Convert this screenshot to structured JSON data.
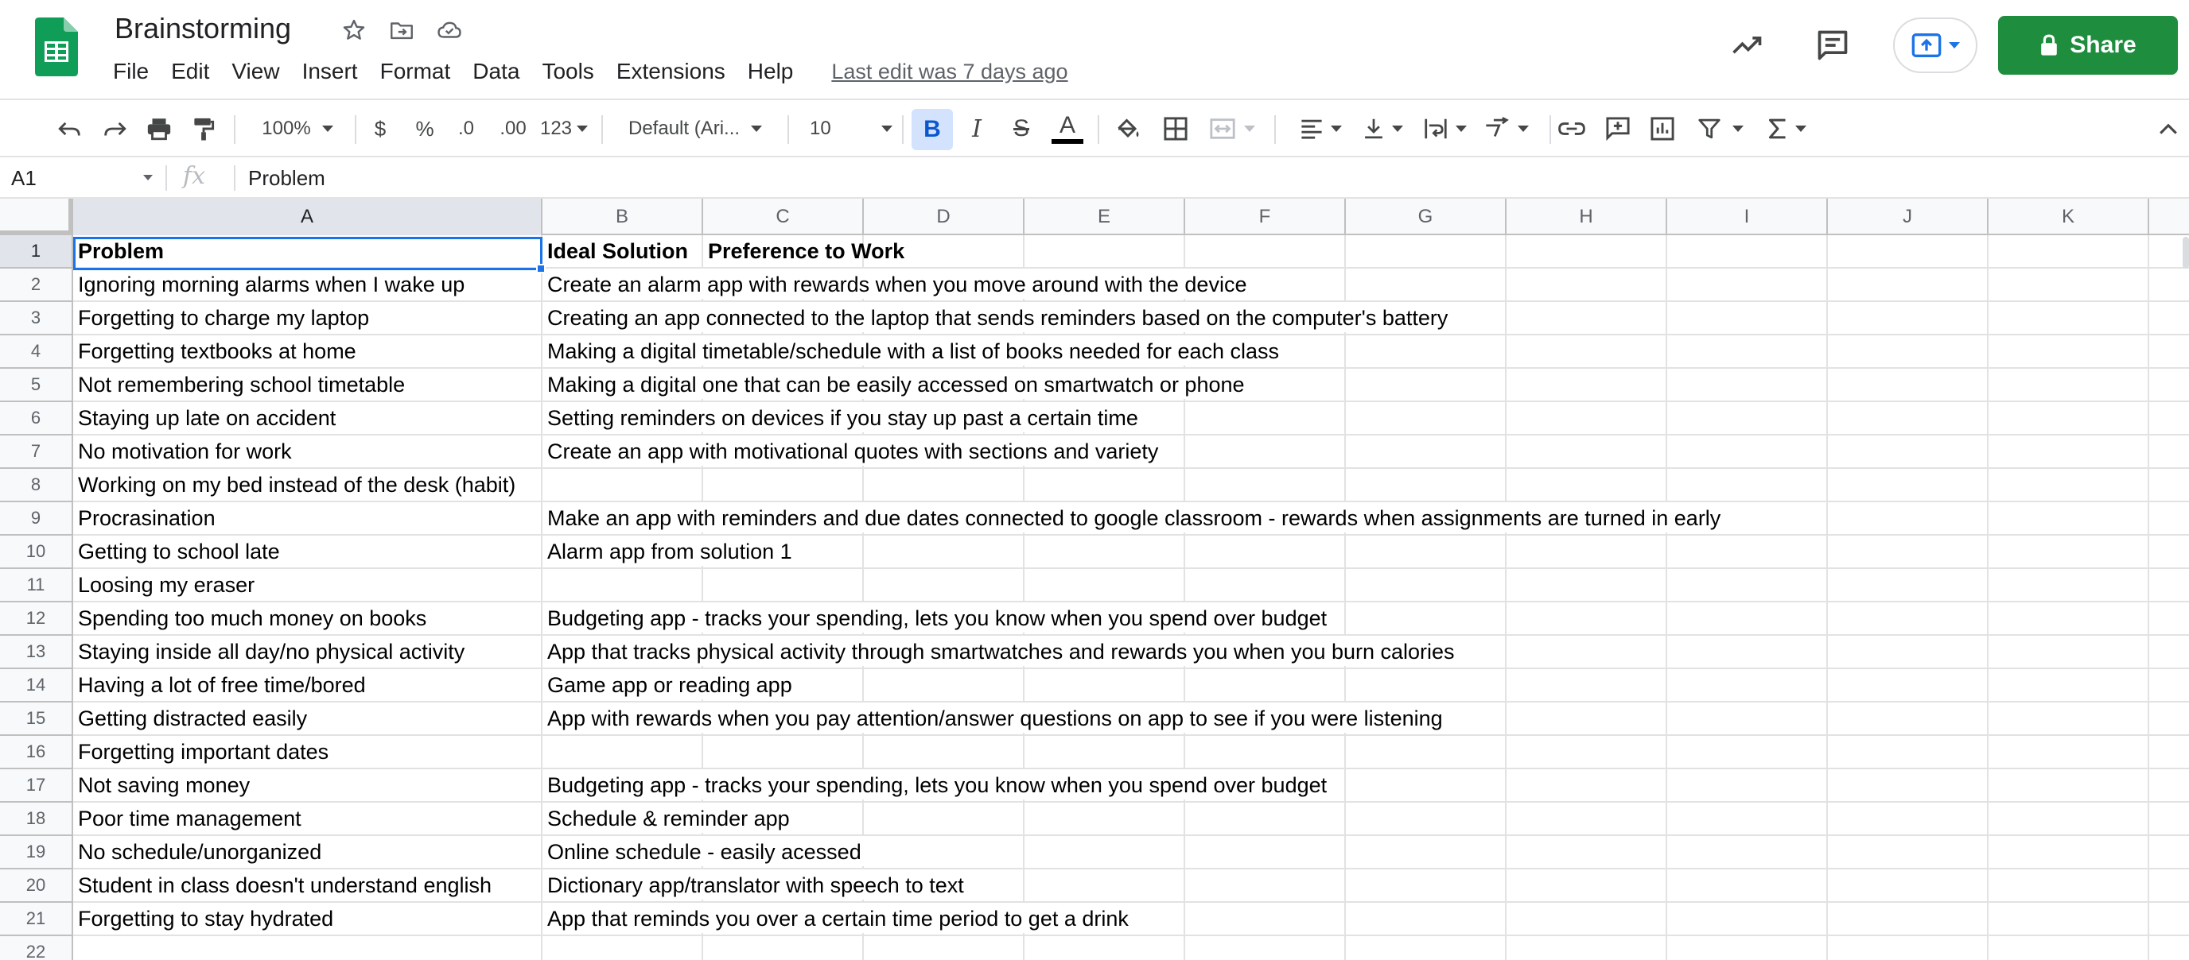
{
  "document": {
    "title": "Brainstorming"
  },
  "menu": {
    "items": [
      "File",
      "Edit",
      "View",
      "Insert",
      "Format",
      "Data",
      "Tools",
      "Extensions",
      "Help"
    ],
    "last_edit": "Last edit was 7 days ago"
  },
  "actions": {
    "share_label": "Share"
  },
  "toolbar": {
    "zoom": "100%",
    "currency": "$",
    "percent": "%",
    "decrease_decimal": ".0",
    "increase_decimal": ".00",
    "more_formats": "123",
    "font": "Default (Ari...",
    "font_size": "10",
    "bold": "B",
    "italic": "I",
    "strikethrough": "S",
    "text_color": "A"
  },
  "formula_bar": {
    "cell_ref": "A1",
    "fx": "fx",
    "value": "Problem"
  },
  "columns": [
    "A",
    "B",
    "C",
    "D",
    "E",
    "F",
    "G",
    "H",
    "I",
    "J",
    "K"
  ],
  "rows": [
    "1",
    "2",
    "3",
    "4",
    "5",
    "6",
    "7",
    "8",
    "9",
    "10",
    "11",
    "12",
    "13",
    "14",
    "15",
    "16",
    "17",
    "18",
    "19",
    "20",
    "21",
    "22"
  ],
  "cells": [
    {
      "a": "Problem",
      "b": "Ideal Solution",
      "c": "Preference to Work"
    },
    {
      "a": "Ignoring morning alarms when I wake up",
      "b": "Create an alarm app with rewards when you move around with the device",
      "c": ""
    },
    {
      "a": "Forgetting to charge my laptop",
      "b": "Creating an app connected to the laptop that sends reminders based on the computer's battery",
      "c": ""
    },
    {
      "a": "Forgetting textbooks at home",
      "b": "Making a digital timetable/schedule with a list of books needed for each class",
      "c": ""
    },
    {
      "a": "Not remembering school timetable",
      "b": "Making a digital one that can be easily accessed on smartwatch or phone",
      "c": ""
    },
    {
      "a": "Staying up late on accident",
      "b": "Setting reminders on devices if you stay up past a certain time",
      "c": ""
    },
    {
      "a": "No motivation for work",
      "b": "Create an app with motivational quotes with sections and variety",
      "c": ""
    },
    {
      "a": "Working on my bed instead of the desk (habit)",
      "b": "",
      "c": ""
    },
    {
      "a": "Procrasination",
      "b": "Make an app with reminders and due dates connected to google classroom - rewards when assignments are turned in early",
      "c": ""
    },
    {
      "a": "Getting to school late",
      "b": "Alarm app from solution 1",
      "c": ""
    },
    {
      "a": "Loosing my eraser",
      "b": "",
      "c": ""
    },
    {
      "a": "Spending too much money on books",
      "b": "Budgeting app - tracks your spending, lets you know when you spend over budget",
      "c": ""
    },
    {
      "a": "Staying inside all day/no physical activity",
      "b": "App that tracks physical activity through smartwatches and rewards you when you burn calories",
      "c": ""
    },
    {
      "a": "Having a lot of free time/bored",
      "b": "Game app or reading app",
      "c": ""
    },
    {
      "a": "Getting distracted easily",
      "b": "App with rewards when you pay attention/answer questions on app to see if you were listening",
      "c": ""
    },
    {
      "a": "Forgetting important dates",
      "b": "",
      "c": ""
    },
    {
      "a": "Not saving money",
      "b": "Budgeting app - tracks your spending, lets you know when you spend over budget",
      "c": ""
    },
    {
      "a": "Poor time management",
      "b": "Schedule & reminder app",
      "c": ""
    },
    {
      "a": "No schedule/unorganized",
      "b": "Online schedule - easily acessed",
      "c": ""
    },
    {
      "a": "Student in class doesn't understand english",
      "b": "Dictionary app/translator with speech to text",
      "c": ""
    },
    {
      "a": "Forgetting to stay hydrated",
      "b": "App that reminds you over a certain time period to get a drink",
      "c": ""
    },
    {
      "a": "",
      "b": "",
      "c": ""
    }
  ],
  "colors": {
    "accent": "#1a73e8",
    "share": "#1e8e3e",
    "logo": "#0f9d58"
  }
}
